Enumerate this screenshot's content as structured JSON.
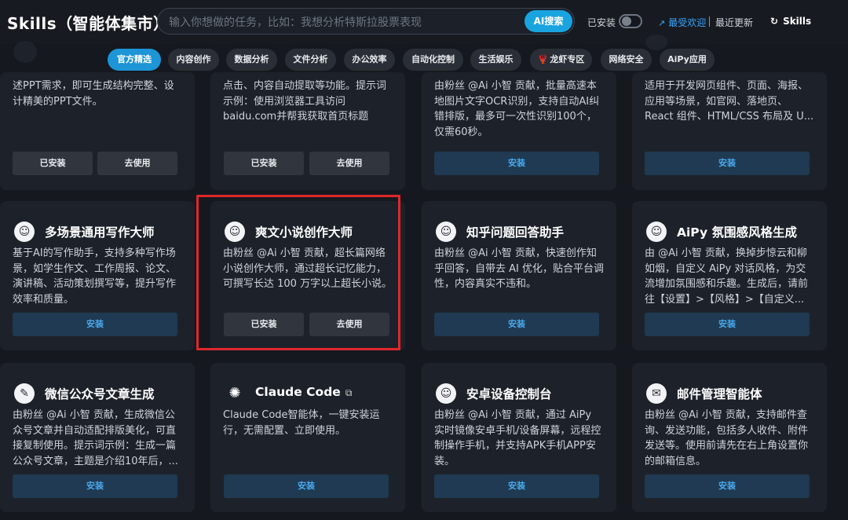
{
  "header": {
    "app_title": "Skills（智能体集市）",
    "search_placeholder": "输入你想做的任务，比如：我想分析特斯拉股票表现",
    "ai_search_label": "AI搜索",
    "installed_toggle_label": "已安装",
    "popular_label": "最受欢迎",
    "recent_label": "最近更新",
    "skills_label": "Skills"
  },
  "tabs": [
    {
      "label": "官方精选",
      "active": true
    },
    {
      "label": "内容创作"
    },
    {
      "label": "数据分析"
    },
    {
      "label": "文件分析"
    },
    {
      "label": "办公效率"
    },
    {
      "label": "自动化控制"
    },
    {
      "label": "生活娱乐"
    },
    {
      "label": "龙虾专区"
    },
    {
      "label": "网络安全"
    },
    {
      "label": "AiPy应用"
    }
  ],
  "cards_row1": [
    {
      "desc": "述PPT需求，即可生成结构完整、设计精美的PPT文件。",
      "installed_label": "已安装",
      "use_label": "去使用"
    },
    {
      "desc": "点击、内容自动提取等功能。提示词示例：使用浏览器工具访问baidu.com并帮我获取首页标题",
      "installed_label": "已安装",
      "use_label": "去使用"
    },
    {
      "desc": "由粉丝 @Ai 小智 贡献，批量高速本地图片文字OCR识别，支持自动AI纠错排版，最多可一次性识别100个，仅需60秒。",
      "install_label": "安装"
    },
    {
      "desc": "适用于开发网页组件、页面、海报、应用等场景，如官网、落地页、React 组件、HTML/CSS 布局及 U...",
      "install_label": "安装"
    }
  ],
  "cards_row2": [
    {
      "title": "多场景通用写作大师",
      "desc": "基于AI的写作助手，支持多种写作场景，如学生作文、工作周报、论文、演讲稿、活动策划撰写等，提升写作效率和质量。",
      "install_label": "安装"
    },
    {
      "title": "爽文小说创作大师",
      "desc": "由粉丝 @Ai 小智 贡献，超长篇网络小说创作大师，通过超长记忆能力，可撰写长达 100 万字以上超长小说。",
      "installed_label": "已安装",
      "use_label": "去使用"
    },
    {
      "title": "知乎问题回答助手",
      "desc": "由粉丝 @Ai 小智 贡献，快速创作知乎回答，自带去 AI 优化，贴合平台调性，内容真实不违和。",
      "install_label": "安装"
    },
    {
      "title": "AiPy 氛围感风格生成",
      "desc": "由 @Ai 小智 贡献，换掉步惊云和柳如烟，自定义 AiPy 对话风格，为交流增加氛围感和乐趣。生成后，请前往【设置】>【风格】>【自定义...",
      "install_label": "安装"
    }
  ],
  "cards_row3": [
    {
      "title": "微信公众号文章生成",
      "desc": "由粉丝 @Ai 小智 贡献，生成微信公众号文章并自动适配排版美化，可直接复制使用。提示词示例：生成一篇公众号文章，主题是介绍10年后，...",
      "install_label": "安装"
    },
    {
      "title": "Claude Code",
      "desc": "Claude Code智能体，一键安装运行，无需配置、立即使用。",
      "install_label": "安装"
    },
    {
      "title": "安卓设备控制台",
      "desc": "由粉丝 @Ai 小智 贡献，通过 AiPy 实时镜像安卓手机/设备屏幕，远程控制操作手机，并支持APK手机APP安装。",
      "install_label": "安装"
    },
    {
      "title": "邮件管理智能体",
      "desc": "由粉丝 @Ai 小智 贡献，支持邮件查询、发送功能，包括多人收件、附件发送等。使用前请先在右上角设置你的邮箱信息。",
      "install_label": "安装"
    }
  ],
  "icons": {
    "card_generic": "robot-icon",
    "wechat": "edit-icon",
    "claude": "sparkle-icon",
    "mail": "mail-icon",
    "lobster": "lobster-icon",
    "external": "external-link-icon"
  }
}
